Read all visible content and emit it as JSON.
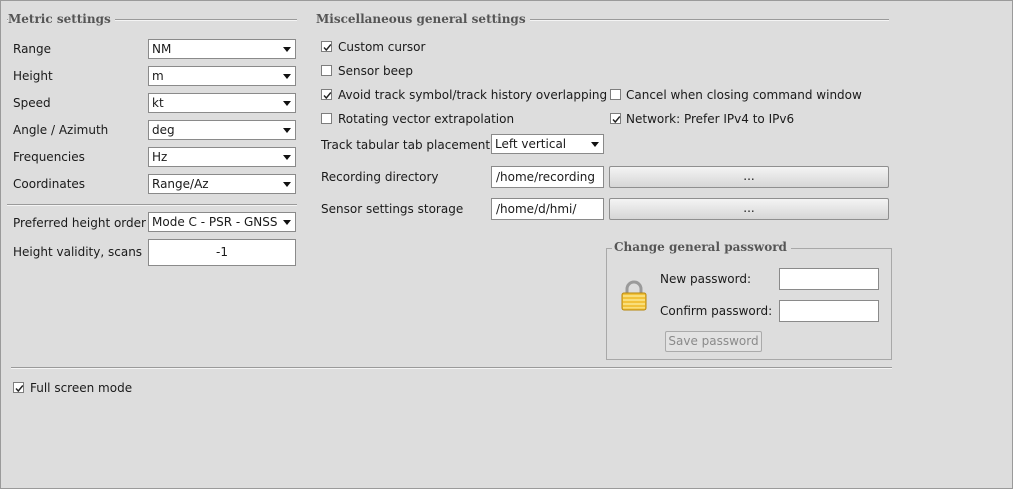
{
  "metric": {
    "title": "Metric settings",
    "rows": [
      {
        "label": "Range",
        "value": "NM"
      },
      {
        "label": "Height",
        "value": "m"
      },
      {
        "label": "Speed",
        "value": "kt"
      },
      {
        "label": "Angle / Azimuth",
        "value": "deg"
      },
      {
        "label": "Frequencies",
        "value": "Hz"
      },
      {
        "label": "Coordinates",
        "value": "Range/Az"
      }
    ],
    "preferred_height_label": "Preferred height order",
    "preferred_height_value": "Mode C - PSR - GNSS",
    "height_validity_label": "Height validity, scans",
    "height_validity_value": "-1"
  },
  "misc": {
    "title": "Miscellaneous general settings",
    "checkboxes": [
      {
        "label": "Custom cursor",
        "checked": true
      },
      {
        "label": "Sensor beep",
        "checked": false
      },
      {
        "label": "Avoid track symbol/track history overlapping",
        "checked": true
      },
      {
        "label": "Rotating vector extrapolation",
        "checked": false
      },
      {
        "label": "Cancel when closing command window",
        "checked": false
      },
      {
        "label": "Network: Prefer IPv4 to IPv6",
        "checked": true
      }
    ],
    "tab_placement_label": "Track tabular tab placement",
    "tab_placement_value": "Left vertical",
    "recording_dir_label": "Recording directory",
    "recording_dir_value": "/home/recording",
    "recording_browse_label": "...",
    "sensor_storage_label": "Sensor settings storage",
    "sensor_storage_value": "/home/d/hmi/",
    "sensor_browse_label": "..."
  },
  "password": {
    "title": "Change general password",
    "new_label": "New password:",
    "new_value": "",
    "confirm_label": "Confirm password:",
    "confirm_value": "",
    "save_label": "Save password",
    "icon": "lock-icon"
  },
  "fullscreen": {
    "label": "Full screen mode",
    "checked": true
  }
}
